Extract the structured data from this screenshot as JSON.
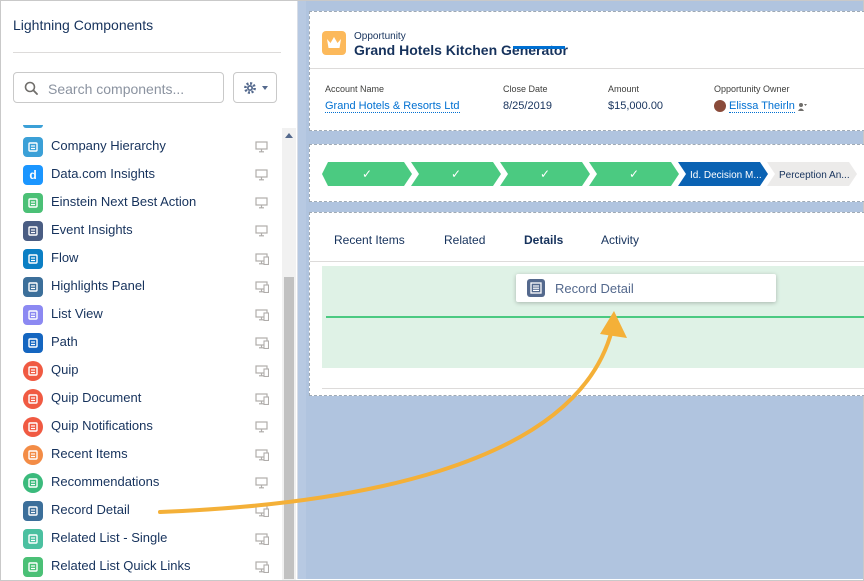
{
  "palette": {
    "title": "Lightning Components",
    "search_placeholder": "Search components...",
    "items": [
      {
        "label": "Company Hierarchy",
        "icon": "hierarchy-icon",
        "color": "#3ba0d7",
        "glyph": "",
        "device": "desktop"
      },
      {
        "label": "Data.com Insights",
        "icon": "datacom-icon",
        "color": "#1b96ff",
        "glyph": "d",
        "device": "desktop"
      },
      {
        "label": "Einstein Next Best Action",
        "icon": "einstein-icon",
        "color": "#4bc076",
        "glyph": "",
        "device": "desktop"
      },
      {
        "label": "Event Insights",
        "icon": "event-insights-icon",
        "color": "#4a5d83",
        "glyph": "",
        "device": "desktop"
      },
      {
        "label": "Flow",
        "icon": "flow-icon",
        "color": "#0b7fc4",
        "glyph": "",
        "device": "desktop-phone"
      },
      {
        "label": "Highlights Panel",
        "icon": "highlights-panel-icon",
        "color": "#3c6f9a",
        "glyph": "",
        "device": "desktop-phone"
      },
      {
        "label": "List View",
        "icon": "list-view-icon",
        "color": "#8c89f2",
        "glyph": "",
        "device": "desktop-phone"
      },
      {
        "label": "Path",
        "icon": "path-icon",
        "color": "#1566c0",
        "glyph": "",
        "device": "desktop-phone"
      },
      {
        "label": "Quip",
        "icon": "quip-icon",
        "color": "#f05a42",
        "glyph": "",
        "device": "desktop-phone"
      },
      {
        "label": "Quip Document",
        "icon": "quip-document-icon",
        "color": "#f05a42",
        "glyph": "",
        "device": "desktop-phone"
      },
      {
        "label": "Quip Notifications",
        "icon": "quip-notifications-icon",
        "color": "#f05a42",
        "glyph": "",
        "device": "desktop"
      },
      {
        "label": "Recent Items",
        "icon": "recent-items-icon",
        "color": "#f38c46",
        "glyph": "",
        "device": "desktop-phone"
      },
      {
        "label": "Recommendations",
        "icon": "recommendations-icon",
        "color": "#3bba7c",
        "glyph": "",
        "device": "desktop"
      },
      {
        "label": "Record Detail",
        "icon": "record-detail-icon",
        "color": "#3c6f9a",
        "glyph": "",
        "device": "desktop-phone"
      },
      {
        "label": "Related List - Single",
        "icon": "related-list-icon",
        "color": "#4bc0a0",
        "glyph": "",
        "device": "desktop-phone"
      },
      {
        "label": "Related List Quick Links",
        "icon": "related-quick-links-icon",
        "color": "#4bc076",
        "glyph": "",
        "device": "desktop-phone"
      }
    ]
  },
  "highlights": {
    "record_type": "Opportunity",
    "record_name": "Grand Hotels Kitchen Generator",
    "fields": [
      {
        "label": "Account Name",
        "value": "Grand Hotels & Resorts Ltd",
        "link": true
      },
      {
        "label": "Close Date",
        "value": "8/25/2019",
        "link": false
      },
      {
        "label": "Amount",
        "value": "$15,000.00",
        "link": false
      },
      {
        "label": "Opportunity Owner",
        "value": "Elissa Theirln",
        "link": true
      }
    ]
  },
  "path": {
    "stages": [
      {
        "label": "✓",
        "state": "complete"
      },
      {
        "label": "✓",
        "state": "complete"
      },
      {
        "label": "✓",
        "state": "complete"
      },
      {
        "label": "✓",
        "state": "complete"
      },
      {
        "label": "Id. Decision M...",
        "state": "current"
      },
      {
        "label": "Perception An...",
        "state": "upcoming"
      }
    ],
    "colors": {
      "complete": "#4bca81",
      "current": "#0a62b3",
      "upcoming": "#ecebea"
    }
  },
  "tabs": {
    "items": [
      "Recent Items",
      "Related",
      "Details",
      "Activity"
    ],
    "active": "Details"
  },
  "drag": {
    "label": "Record Detail"
  }
}
